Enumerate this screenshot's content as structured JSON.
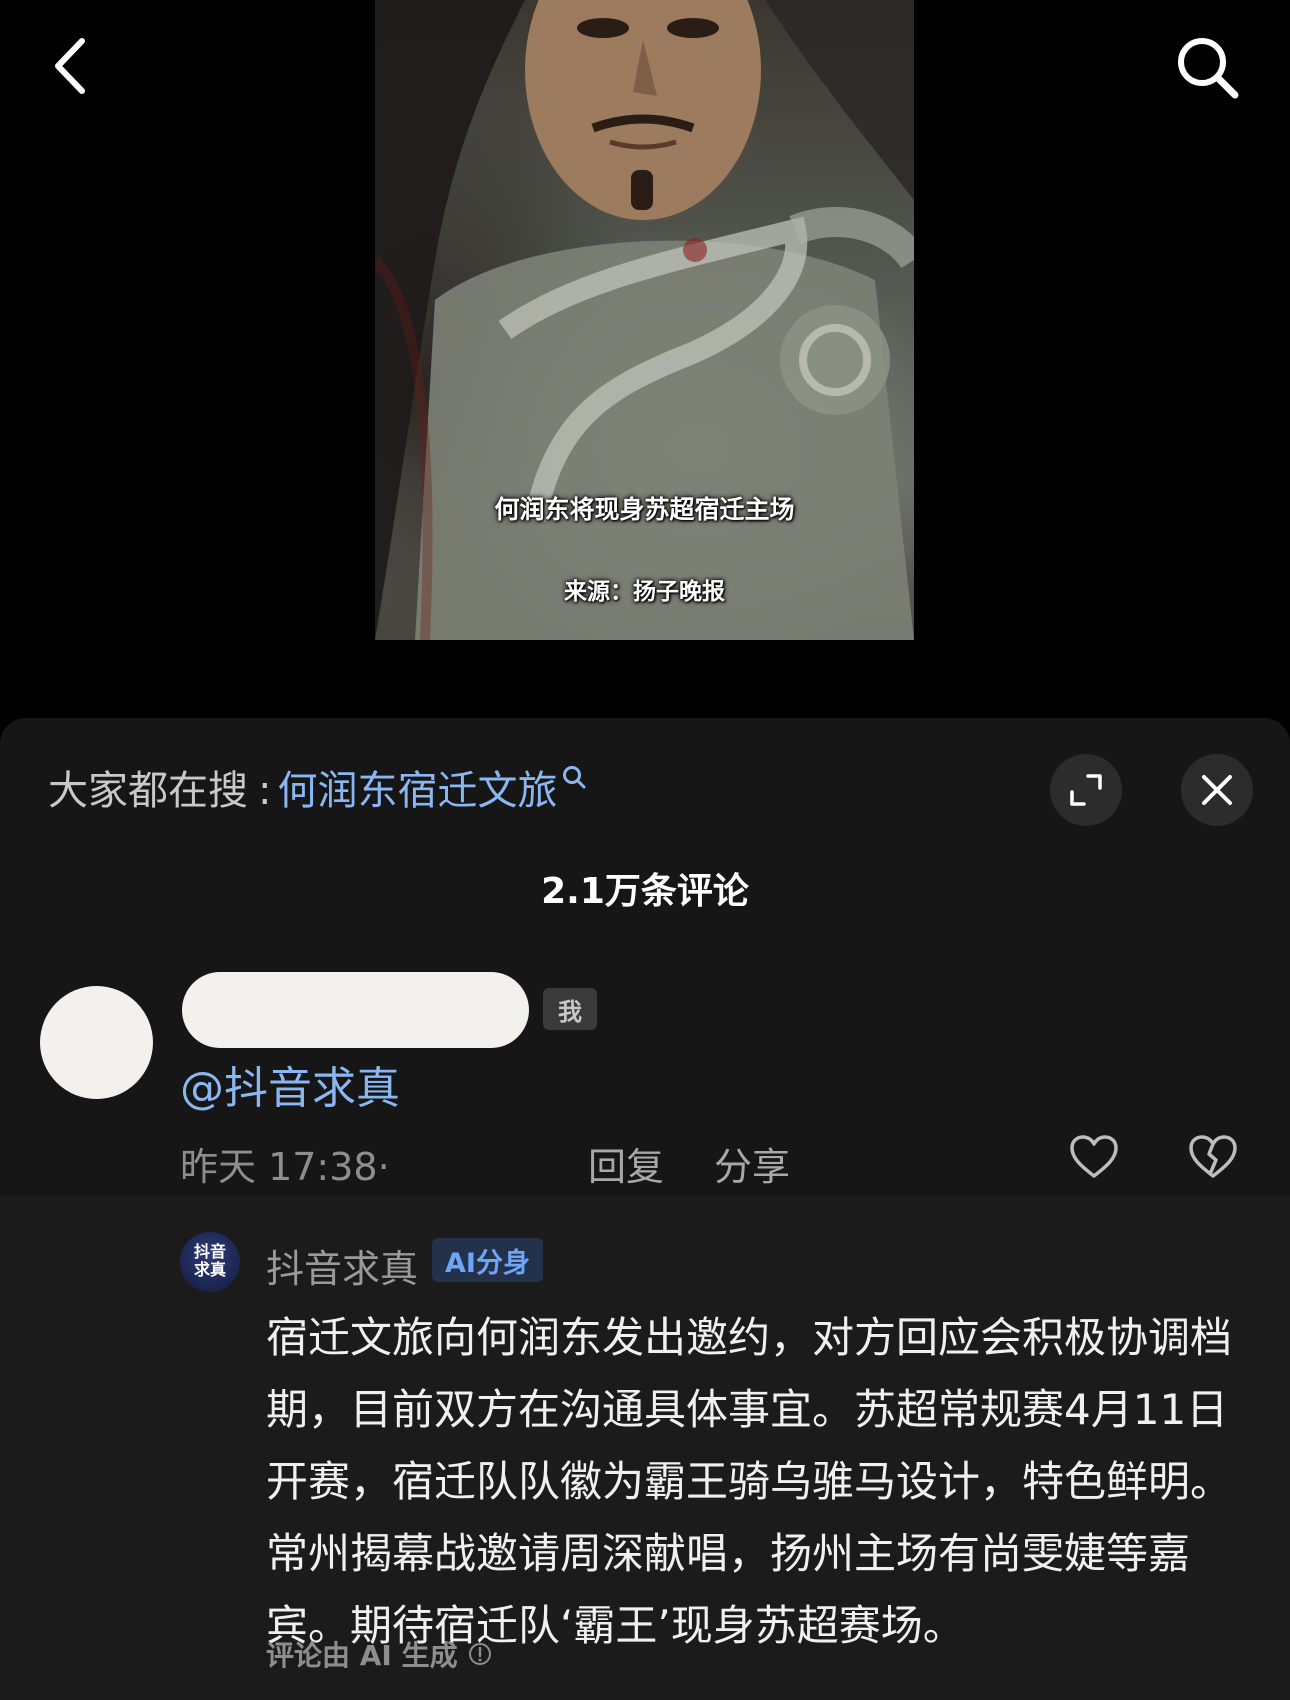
{
  "video": {
    "caption": "何润东将现身苏超宿迁主场",
    "source": "来源：扬子晚报"
  },
  "icons": {
    "back": "chevron-left-icon",
    "search": "search-icon",
    "expand": "expand-icon",
    "close": "close-icon",
    "like": "heart-icon",
    "dislike": "broken-heart-icon",
    "info": "info-icon"
  },
  "hot_search": {
    "label": "大家都在搜",
    "colon": ":",
    "keyword": "何润东宿迁文旅"
  },
  "comments": {
    "count_label": "2.1万条评论"
  },
  "comment": {
    "me_badge": "我",
    "text": "@抖音求真",
    "timestamp": "昨天 17:38·",
    "reply_label": "回复",
    "share_label": "分享"
  },
  "reply": {
    "avatar_line1": "抖音",
    "avatar_line2": "求真",
    "author": "抖音求真",
    "badge": "AI分身",
    "text": "宿迁文旅向何润东发出邀约，对方回应会积极协调档期，目前双方在沟通具体事宜。苏超常规赛4月11日开赛，宿迁队队徽为霸王骑乌骓马设计，特色鲜明。常州揭幕战邀请周深献唱，扬州主场有尚雯婕等嘉宾。期待宿迁队‘霸王’现身苏超赛场。",
    "ai_note": "评论由 AI 生成"
  },
  "colors": {
    "panel_bg": "#161616",
    "link_blue": "#8ab7f2",
    "ai_badge_text": "#6ea6f5"
  }
}
